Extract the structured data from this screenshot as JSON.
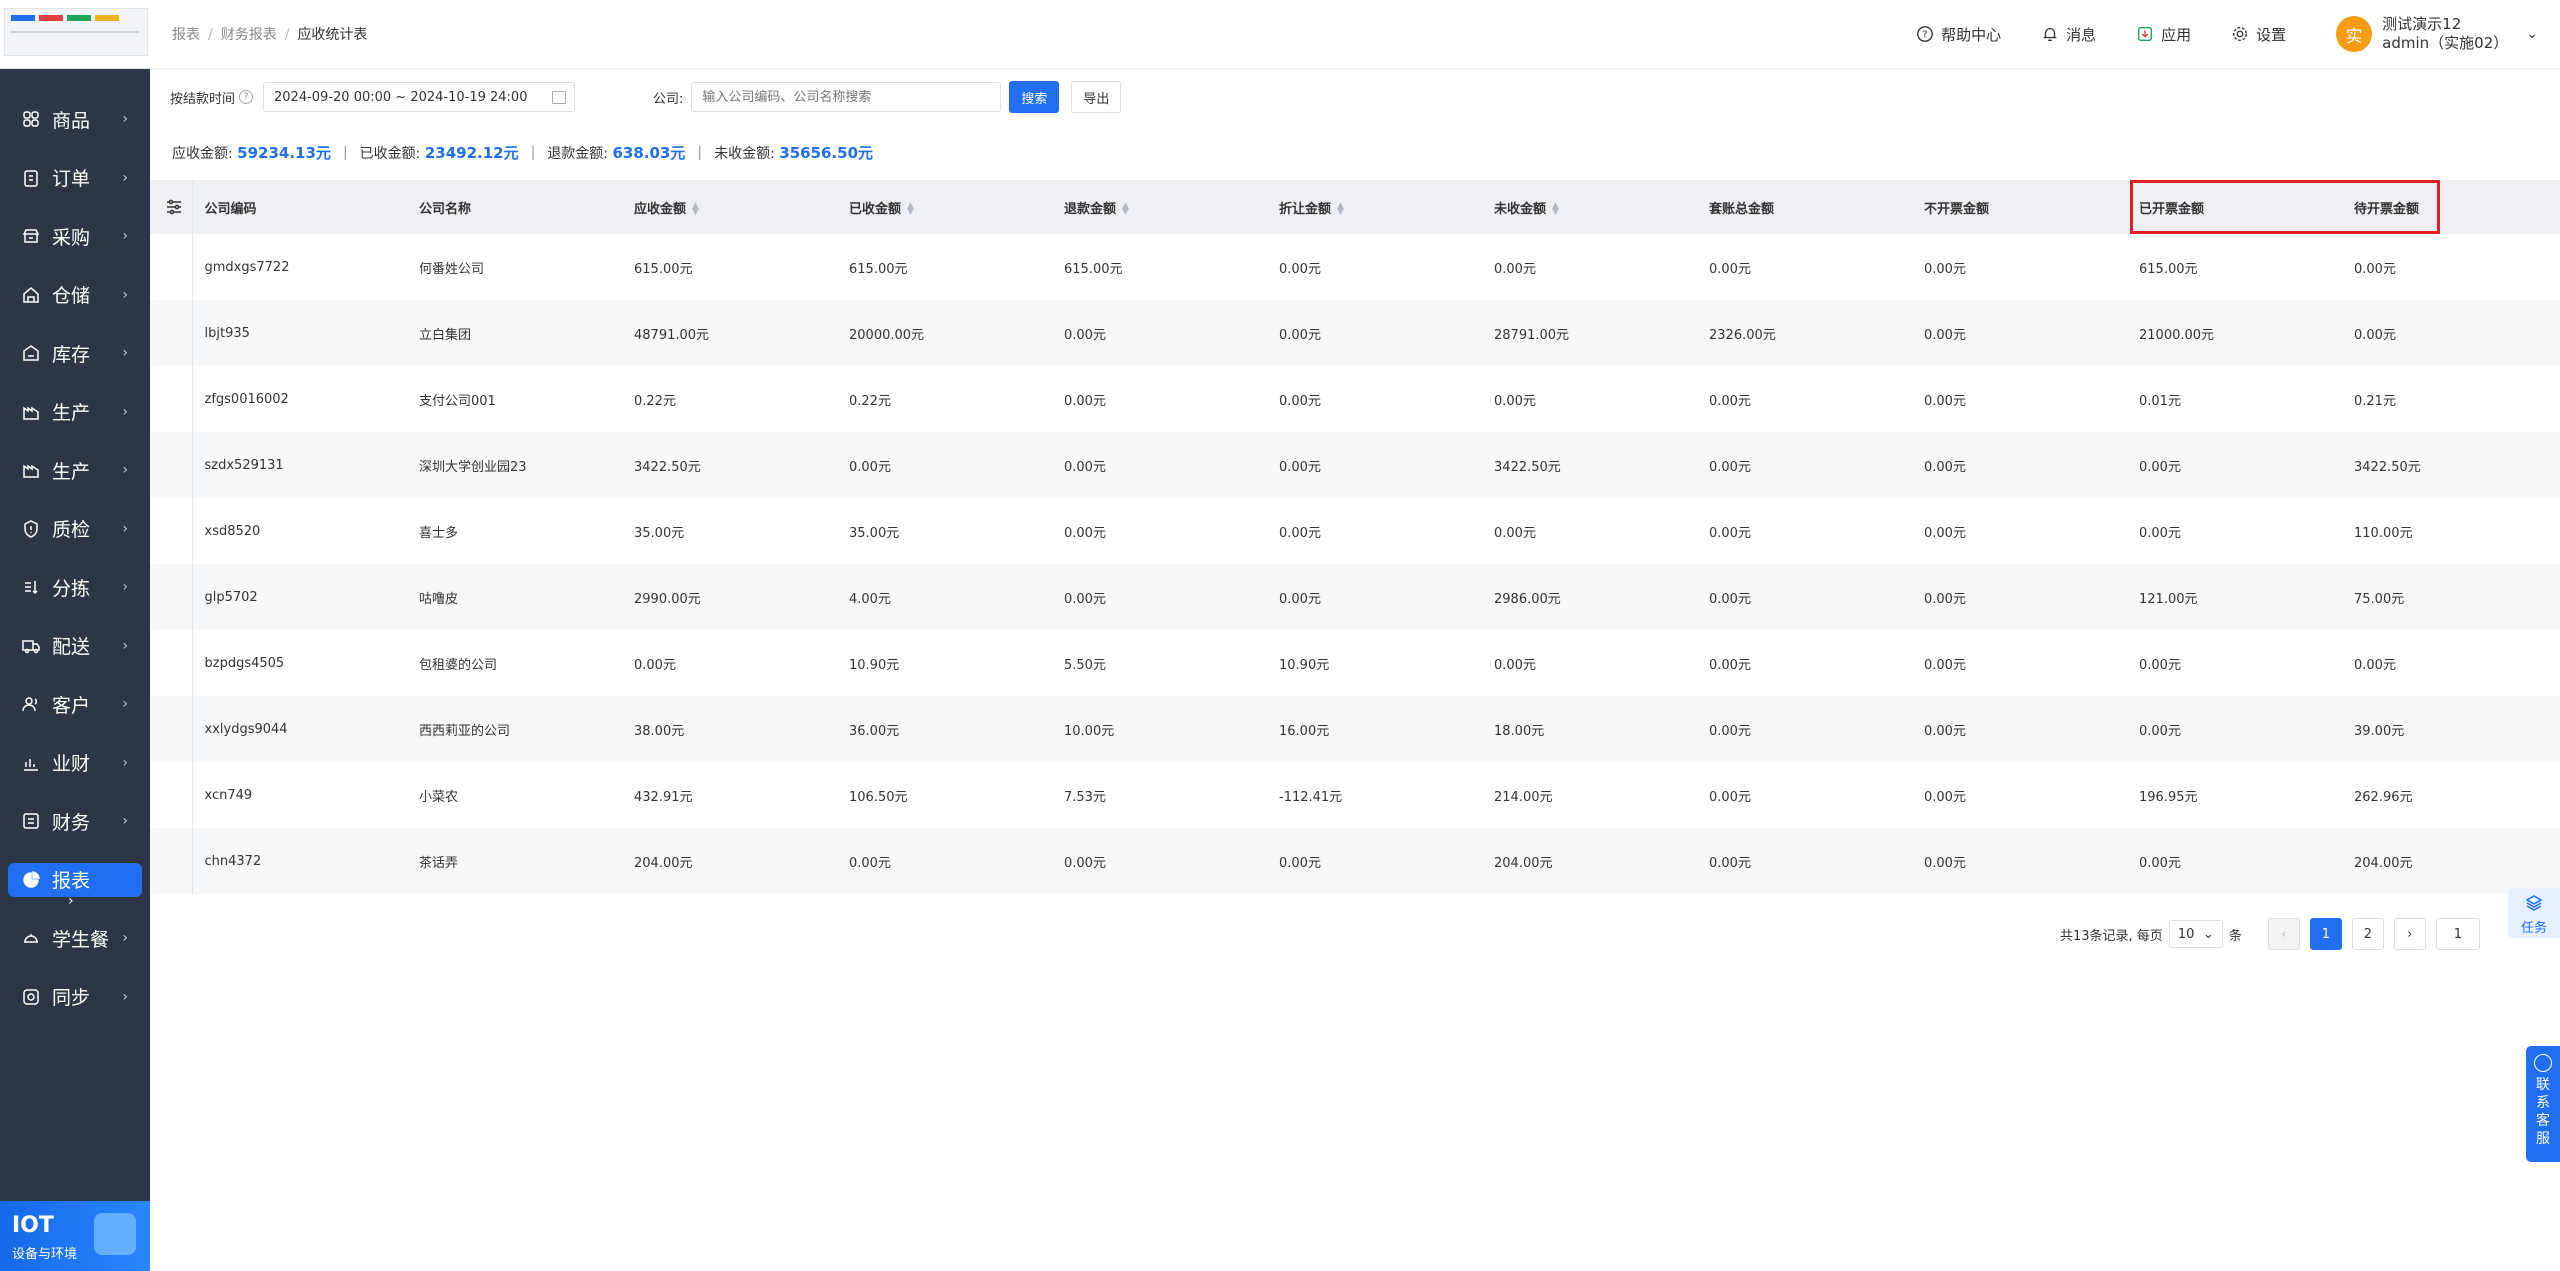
{
  "sidebar": {
    "items": [
      {
        "label": "商品",
        "icon": "grid-icon"
      },
      {
        "label": "订单",
        "icon": "clipboard-icon"
      },
      {
        "label": "采购",
        "icon": "shop-icon"
      },
      {
        "label": "仓储",
        "icon": "warehouse-icon"
      },
      {
        "label": "库存",
        "icon": "inventory-icon"
      },
      {
        "label": "生产",
        "icon": "factory-icon"
      },
      {
        "label": "生产",
        "icon": "factory-icon"
      },
      {
        "label": "质检",
        "icon": "shield-icon"
      },
      {
        "label": "分拣",
        "icon": "sort-icon"
      },
      {
        "label": "配送",
        "icon": "truck-icon"
      },
      {
        "label": "客户",
        "icon": "users-icon"
      },
      {
        "label": "业财",
        "icon": "chart-icon"
      },
      {
        "label": "财务",
        "icon": "finance-icon"
      },
      {
        "label": "报表",
        "icon": "pie-icon",
        "active": true
      },
      {
        "label": "学生餐",
        "icon": "meal-icon"
      },
      {
        "label": "同步",
        "icon": "sync-icon"
      }
    ],
    "iot_title": "IOT",
    "iot_subtitle": "设备与环境"
  },
  "breadcrumb": {
    "l1": "报表",
    "l2": "财务报表",
    "l3": "应收统计表"
  },
  "header": {
    "help": "帮助中心",
    "msg": "消息",
    "app": "应用",
    "settings": "设置",
    "avatar_char": "实",
    "user_name": "测试演示12",
    "user_role": "admin（实施02）"
  },
  "filter": {
    "time_label": "按结款时间",
    "date_range": "2024-09-20 00:00 ~ 2024-10-19 24:00",
    "company_label": "公司:",
    "company_placeholder": "输入公司编码、公司名称搜索",
    "search_btn": "搜索",
    "export_btn": "导出"
  },
  "summary": {
    "receivable_label": "应收金额:",
    "receivable": "59234.13元",
    "received_label": "已收金额:",
    "received": "23492.12元",
    "refund_label": "退款金额:",
    "refund": "638.03元",
    "unreceived_label": "未收金额:",
    "unreceived": "35656.50元"
  },
  "table": {
    "columns": [
      "公司编码",
      "公司名称",
      "应收金额",
      "已收金额",
      "退款金额",
      "折让金额",
      "未收金额",
      "套账总金额",
      "不开票金额",
      "已开票金额",
      "待开票金额"
    ],
    "rows": [
      [
        "gmdxgs7722",
        "何番姓公司",
        "615.00元",
        "615.00元",
        "615.00元",
        "0.00元",
        "0.00元",
        "0.00元",
        "0.00元",
        "615.00元",
        "0.00元"
      ],
      [
        "lbjt935",
        "立白集团",
        "48791.00元",
        "20000.00元",
        "0.00元",
        "0.00元",
        "28791.00元",
        "2326.00元",
        "0.00元",
        "21000.00元",
        "0.00元"
      ],
      [
        "zfgs0016002",
        "支付公司001",
        "0.22元",
        "0.22元",
        "0.00元",
        "0.00元",
        "0.00元",
        "0.00元",
        "0.00元",
        "0.01元",
        "0.21元"
      ],
      [
        "szdx529131",
        "深圳大学创业园23",
        "3422.50元",
        "0.00元",
        "0.00元",
        "0.00元",
        "3422.50元",
        "0.00元",
        "0.00元",
        "0.00元",
        "3422.50元"
      ],
      [
        "xsd8520",
        "喜士多",
        "35.00元",
        "35.00元",
        "0.00元",
        "0.00元",
        "0.00元",
        "0.00元",
        "0.00元",
        "0.00元",
        "110.00元"
      ],
      [
        "glp5702",
        "咕噜皮",
        "2990.00元",
        "4.00元",
        "0.00元",
        "0.00元",
        "2986.00元",
        "0.00元",
        "0.00元",
        "121.00元",
        "75.00元"
      ],
      [
        "bzpdgs4505",
        "包租婆的公司",
        "0.00元",
        "10.90元",
        "5.50元",
        "10.90元",
        "0.00元",
        "0.00元",
        "0.00元",
        "0.00元",
        "0.00元"
      ],
      [
        "xxlydgs9044",
        "西西莉亚的公司",
        "38.00元",
        "36.00元",
        "10.00元",
        "16.00元",
        "18.00元",
        "0.00元",
        "0.00元",
        "0.00元",
        "39.00元"
      ],
      [
        "xcn749",
        "小菜农",
        "432.91元",
        "106.50元",
        "7.53元",
        "-112.41元",
        "214.00元",
        "0.00元",
        "0.00元",
        "196.95元",
        "262.96元"
      ],
      [
        "chn4372",
        "茶话弄",
        "204.00元",
        "0.00元",
        "0.00元",
        "0.00元",
        "204.00元",
        "0.00元",
        "0.00元",
        "0.00元",
        "204.00元"
      ]
    ]
  },
  "pager": {
    "total_text": "共13条记录, 每页",
    "page_size": "10",
    "unit": "条",
    "pages": [
      "1",
      "2"
    ],
    "jump": "1"
  },
  "float": {
    "task": "任务",
    "cs": [
      "联",
      "系",
      "客",
      "服"
    ]
  }
}
